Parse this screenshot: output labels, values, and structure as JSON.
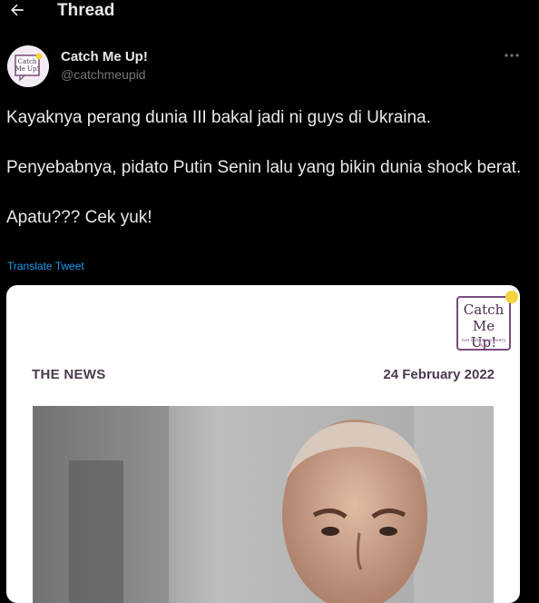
{
  "header": {
    "title": "Thread",
    "back_icon": "arrow-left-icon"
  },
  "tweet": {
    "author_name": "Catch Me Up!",
    "author_handle": "@catchmeupid",
    "avatar": {
      "line1": "Catch",
      "line2": "Me Up!"
    },
    "paragraphs": [
      "Kayaknya perang dunia III bakal jadi ni guys di Ukraina.",
      "Penyebabnya, pidato Putin Senin lalu yang bikin dunia shock berat.",
      "Apatu??? Cek yuk!"
    ],
    "translate_label": "Translate Tweet"
  },
  "card": {
    "logo_line1": "Catch",
    "logo_line2": "Me Up!",
    "logo_tagline": "Get informed every AM",
    "section_label": "THE NEWS",
    "date": "24 February 2022"
  },
  "colors": {
    "background": "#000000",
    "text": "#e7e9ea",
    "secondary": "#71767b",
    "link": "#1d9bf0",
    "brand": "#7a4a7c",
    "brand_dot": "#f5d33a"
  }
}
